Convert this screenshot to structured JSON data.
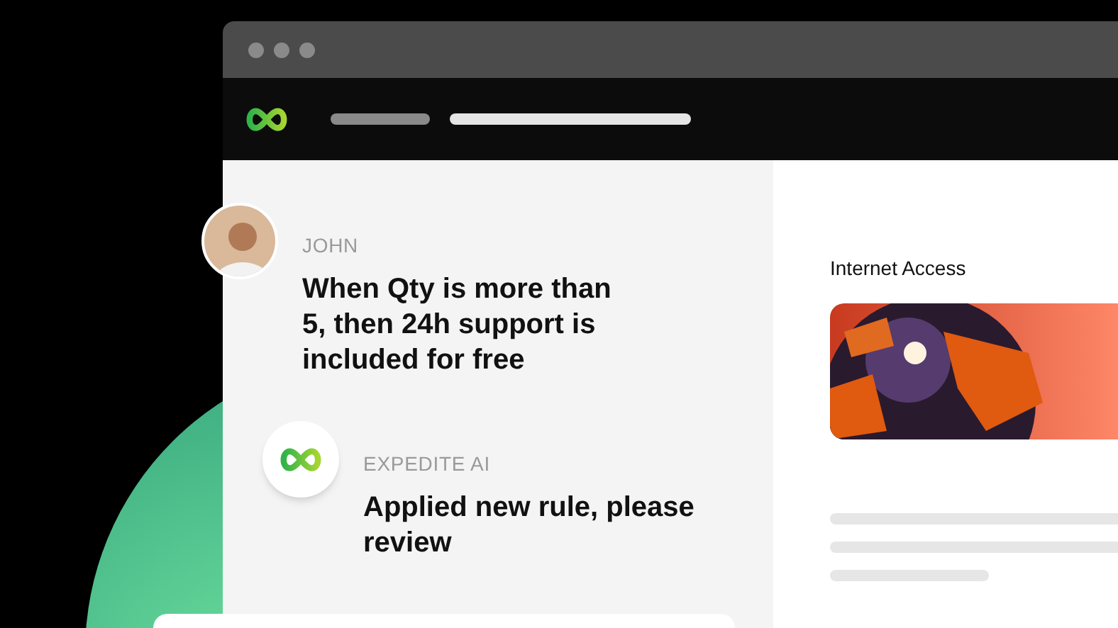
{
  "chat": [
    {
      "kind": "user",
      "name": "JOHN",
      "text": "When Qty is more than 5, then 24h support is included for free"
    },
    {
      "kind": "ai",
      "name": "EXPEDITE AI",
      "text": "Applied new rule, please review"
    }
  ],
  "panel": {
    "title": "Internet Access"
  }
}
